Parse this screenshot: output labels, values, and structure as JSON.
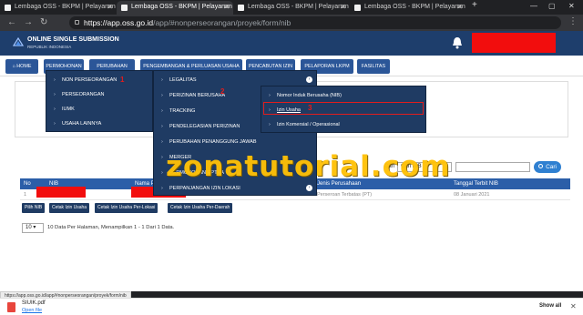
{
  "browser": {
    "tabs": [
      {
        "label": "Lembaga OSS - BKPM | Pelayanan"
      },
      {
        "label": "Lembaga OSS - BKPM | Pelayanan"
      },
      {
        "label": "Lembaga OSS - BKPM | Pelayanan"
      },
      {
        "label": "Lembaga OSS - BKPM | Pelayanan"
      }
    ],
    "new_tab_label": "+",
    "url_host": "https://app.oss.go.id",
    "url_path": "/app/#nonperseorangan/proyek/form/nib",
    "status_url": "https://app.oss.go.id/app/#nonperseorangan/proyek/form/nib"
  },
  "header": {
    "title": "ONLINE SINGLE SUBMISSION",
    "subtitle": "REPUBLIK INDONESIA",
    "user_color": "#f20d0d"
  },
  "menu": [
    {
      "label": "HOME"
    },
    {
      "label": "PERMOHONAN"
    },
    {
      "label": "PERUBAHAN"
    },
    {
      "label": "PENGEMBANGAN & PERLUASAN USAHA"
    },
    {
      "label": "PENCABUTAN IZIN"
    },
    {
      "label": "PELAPORAN LKPM"
    },
    {
      "label": "FASILITAS"
    }
  ],
  "dropdown1": [
    {
      "label": "NON PERSEORANGAN"
    },
    {
      "label": "PERSEORANGAN"
    },
    {
      "label": "IUMK"
    },
    {
      "label": "USAHA LAINNYA"
    }
  ],
  "dropdown2": [
    {
      "label": "LEGALITAS"
    },
    {
      "label": "PERIZINAN BERUSAHA"
    },
    {
      "label": "TRACKING"
    },
    {
      "label": "PENDELEGASIAN PERIZINAN"
    },
    {
      "label": "PERUBAHAN PENANGGUNG JAWAB"
    },
    {
      "label": "MERGER"
    },
    {
      "label": "PERMOHONAN RPTKA"
    },
    {
      "label": "PERPANJANGAN IZIN LOKASI"
    }
  ],
  "dropdown3": [
    {
      "label": "Nomor Induk Berusaha (NIB)"
    },
    {
      "label": "Izin Usaha"
    },
    {
      "label": "Izin Komersial / Operasional"
    }
  ],
  "annotations": {
    "step1": "1",
    "step2": "2",
    "step3": "3",
    "highlight_color": "#e31c1c"
  },
  "watermark": "zonatutorial.com",
  "search": {
    "label": "Cari",
    "select_value": "Cari NIB",
    "button_label": "Cari"
  },
  "table": {
    "headers": [
      "No",
      "NIB",
      "Nama P",
      "Jenis Perusahaan",
      "Tanggal Terbit NIB"
    ],
    "rows": [
      {
        "no": "1",
        "jenis": "Perseroan Terbatas (PT)",
        "tanggal": "08 Januari 2021"
      }
    ]
  },
  "actions": [
    {
      "label": "Pilih NIB"
    },
    {
      "label": "Cetak Izin Usaha"
    },
    {
      "label": "Cetak Izin Usaha Per-Lokasi"
    },
    {
      "label": "Cetak Izin Usaha Per-Daerah"
    }
  ],
  "pagination": {
    "per_page": "10",
    "info": "10 Data Per Halaman, Menampilkan 1 - 1 Dari 1 Data."
  },
  "download": {
    "file_name": "SIUIK.pdf",
    "open_label": "Open file",
    "show_all": "Show all"
  }
}
